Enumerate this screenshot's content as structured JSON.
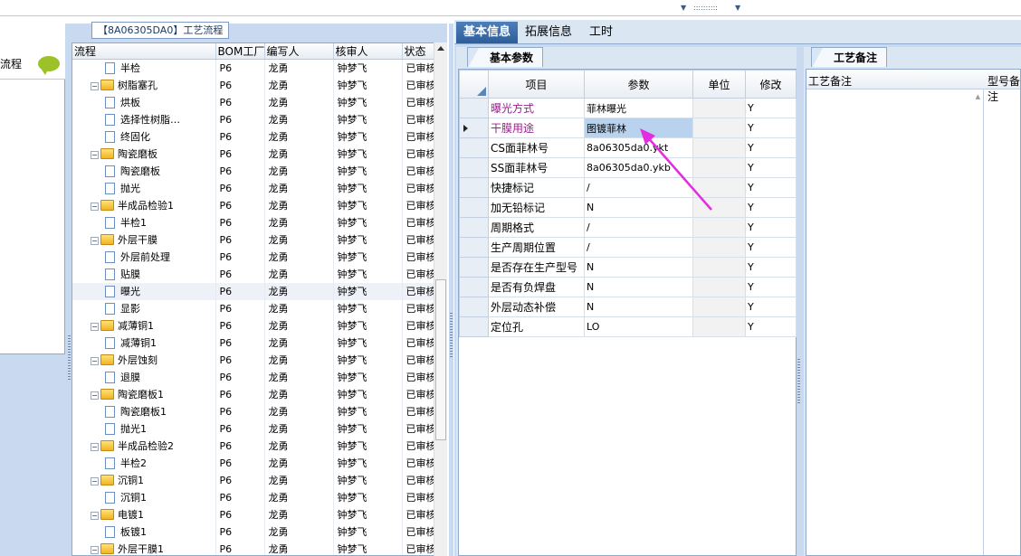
{
  "left_panel": {
    "label": "流程"
  },
  "flow_panel": {
    "title": "【8A06305DA0】工艺流程",
    "columns": [
      "流程",
      "BOM工厂",
      "编写人",
      "核审人",
      "状态"
    ],
    "rows": [
      {
        "name": "半检",
        "level": 2,
        "factory": "P6",
        "author": "龙勇",
        "reviewer": "钟梦飞",
        "status": "已审核"
      },
      {
        "name": "树脂塞孔",
        "level": 1,
        "factory": "P6",
        "author": "龙勇",
        "reviewer": "钟梦飞",
        "status": "已审核"
      },
      {
        "name": "烘板",
        "level": 2,
        "factory": "P6",
        "author": "龙勇",
        "reviewer": "钟梦飞",
        "status": "已审核"
      },
      {
        "name": "选择性树脂…",
        "level": 2,
        "factory": "P6",
        "author": "龙勇",
        "reviewer": "钟梦飞",
        "status": "已审核"
      },
      {
        "name": "终固化",
        "level": 2,
        "factory": "P6",
        "author": "龙勇",
        "reviewer": "钟梦飞",
        "status": "已审核"
      },
      {
        "name": "陶瓷磨板",
        "level": 1,
        "factory": "P6",
        "author": "龙勇",
        "reviewer": "钟梦飞",
        "status": "已审核"
      },
      {
        "name": "陶瓷磨板",
        "level": 2,
        "factory": "P6",
        "author": "龙勇",
        "reviewer": "钟梦飞",
        "status": "已审核"
      },
      {
        "name": "抛光",
        "level": 2,
        "factory": "P6",
        "author": "龙勇",
        "reviewer": "钟梦飞",
        "status": "已审核"
      },
      {
        "name": "半成品检验1",
        "level": 1,
        "factory": "P6",
        "author": "龙勇",
        "reviewer": "钟梦飞",
        "status": "已审核"
      },
      {
        "name": "半检1",
        "level": 2,
        "factory": "P6",
        "author": "龙勇",
        "reviewer": "钟梦飞",
        "status": "已审核"
      },
      {
        "name": "外层干膜",
        "level": 1,
        "factory": "P6",
        "author": "龙勇",
        "reviewer": "钟梦飞",
        "status": "已审核"
      },
      {
        "name": "外层前处理",
        "level": 2,
        "factory": "P6",
        "author": "龙勇",
        "reviewer": "钟梦飞",
        "status": "已审核"
      },
      {
        "name": "贴膜",
        "level": 2,
        "factory": "P6",
        "author": "龙勇",
        "reviewer": "钟梦飞",
        "status": "已审核"
      },
      {
        "name": "曝光",
        "level": 2,
        "factory": "P6",
        "author": "龙勇",
        "reviewer": "钟梦飞",
        "status": "已审核",
        "selected": true
      },
      {
        "name": "显影",
        "level": 2,
        "factory": "P6",
        "author": "龙勇",
        "reviewer": "钟梦飞",
        "status": "已审核"
      },
      {
        "name": "减薄铜1",
        "level": 1,
        "factory": "P6",
        "author": "龙勇",
        "reviewer": "钟梦飞",
        "status": "已审核"
      },
      {
        "name": "减薄铜1",
        "level": 2,
        "factory": "P6",
        "author": "龙勇",
        "reviewer": "钟梦飞",
        "status": "已审核"
      },
      {
        "name": "外层蚀刻",
        "level": 1,
        "factory": "P6",
        "author": "龙勇",
        "reviewer": "钟梦飞",
        "status": "已审核"
      },
      {
        "name": "退膜",
        "level": 2,
        "factory": "P6",
        "author": "龙勇",
        "reviewer": "钟梦飞",
        "status": "已审核"
      },
      {
        "name": "陶瓷磨板1",
        "level": 1,
        "factory": "P6",
        "author": "龙勇",
        "reviewer": "钟梦飞",
        "status": "已审核"
      },
      {
        "name": "陶瓷磨板1",
        "level": 2,
        "factory": "P6",
        "author": "龙勇",
        "reviewer": "钟梦飞",
        "status": "已审核"
      },
      {
        "name": "抛光1",
        "level": 2,
        "factory": "P6",
        "author": "龙勇",
        "reviewer": "钟梦飞",
        "status": "已审核"
      },
      {
        "name": "半成品检验2",
        "level": 1,
        "factory": "P6",
        "author": "龙勇",
        "reviewer": "钟梦飞",
        "status": "已审核"
      },
      {
        "name": "半检2",
        "level": 2,
        "factory": "P6",
        "author": "龙勇",
        "reviewer": "钟梦飞",
        "status": "已审核"
      },
      {
        "name": "沉铜1",
        "level": 1,
        "factory": "P6",
        "author": "龙勇",
        "reviewer": "钟梦飞",
        "status": "已审核"
      },
      {
        "name": "沉铜1",
        "level": 2,
        "factory": "P6",
        "author": "龙勇",
        "reviewer": "钟梦飞",
        "status": "已审核"
      },
      {
        "name": "电镀1",
        "level": 1,
        "factory": "P6",
        "author": "龙勇",
        "reviewer": "钟梦飞",
        "status": "已审核"
      },
      {
        "name": "板镀1",
        "level": 2,
        "factory": "P6",
        "author": "龙勇",
        "reviewer": "钟梦飞",
        "status": "已审核"
      },
      {
        "name": "外层干膜1",
        "level": 1,
        "factory": "P6",
        "author": "龙勇",
        "reviewer": "钟梦飞",
        "status": "已审核"
      }
    ]
  },
  "tabs": [
    "基本信息",
    "拓展信息",
    "工时"
  ],
  "basic_panel": {
    "tab_label": "基本参数",
    "columns": [
      "项目",
      "参数",
      "单位",
      "修改"
    ],
    "rows": [
      {
        "item": "曝光方式",
        "param": "菲林曝光",
        "unit": "",
        "modify": "Y",
        "highlight": true
      },
      {
        "item": "干膜用途",
        "param": "图镀菲林",
        "unit": "",
        "modify": "Y",
        "highlight": true,
        "current": true
      },
      {
        "item": "CS面菲林号",
        "param": "8a06305da0.ykt",
        "unit": "",
        "modify": "Y"
      },
      {
        "item": "SS面菲林号",
        "param": "8a06305da0.ykb",
        "unit": "",
        "modify": "Y"
      },
      {
        "item": "快捷标记",
        "param": "/",
        "unit": "",
        "modify": "Y"
      },
      {
        "item": "加无铅标记",
        "param": "N",
        "unit": "",
        "modify": "Y"
      },
      {
        "item": "周期格式",
        "param": "/",
        "unit": "",
        "modify": "Y"
      },
      {
        "item": "生产周期位置",
        "param": "/",
        "unit": "",
        "modify": "Y"
      },
      {
        "item": "是否存在生产型号",
        "param": "N",
        "unit": "",
        "modify": "Y"
      },
      {
        "item": "是否有负焊盘",
        "param": "N",
        "unit": "",
        "modify": "Y"
      },
      {
        "item": "外层动态补偿",
        "param": "N",
        "unit": "",
        "modify": "Y"
      },
      {
        "item": "定位孔",
        "param": "LO",
        "unit": "",
        "modify": "Y"
      }
    ]
  },
  "note_panel": {
    "tab_label": "工艺备注",
    "columns": [
      "工艺备注",
      "型号备注"
    ]
  },
  "colors": {
    "highlight_text": "#9b1d8f",
    "annotation_arrow": "#e22de0",
    "active_tab": "#2d5e9b"
  }
}
